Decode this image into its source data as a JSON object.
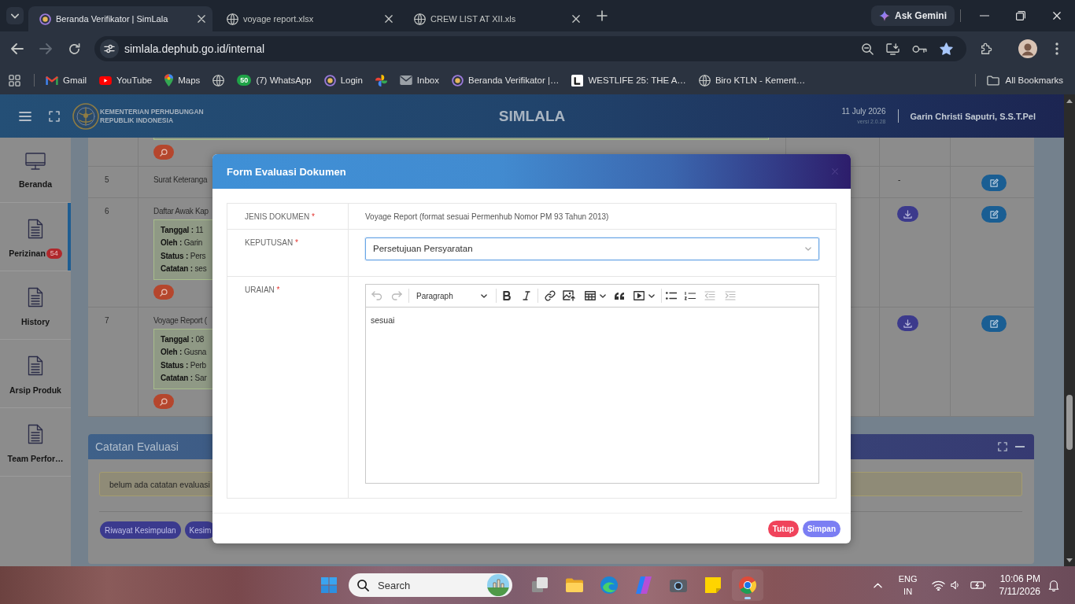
{
  "browser": {
    "tabs": [
      {
        "title": "Beranda Verifikator | SimLala",
        "selected": true
      },
      {
        "title": "voyage report.xlsx",
        "selected": false
      },
      {
        "title": "CREW LIST AT XII.xls",
        "selected": false
      }
    ],
    "gemini_button": "Ask Gemini",
    "forward_disabled": true,
    "address": "simlala.dephub.go.id/internal",
    "bookmarked": true,
    "bookmarks": [
      {
        "kind": "link",
        "label": "Gmail"
      },
      {
        "kind": "link",
        "label": "YouTube"
      },
      {
        "kind": "link",
        "label": "Maps"
      },
      {
        "kind": "icon"
      },
      {
        "kind": "link",
        "label": "(7) WhatsApp",
        "badge": "50"
      },
      {
        "kind": "link",
        "label": "Login"
      },
      {
        "kind": "icon"
      },
      {
        "kind": "link",
        "label": "Inbox"
      },
      {
        "kind": "link",
        "label": "Beranda Verifikator |…"
      },
      {
        "kind": "link",
        "label": "WESTLIFE 25: THE A…"
      },
      {
        "kind": "link",
        "label": "Biro KTLN - Kement…"
      }
    ],
    "all_bookmarks": "All Bookmarks"
  },
  "app": {
    "header": {
      "org_name": "KEMENTERIAN PERHUBUNGAN",
      "org_country": "REPUBLIK INDONESIA",
      "title": "SIMLALA",
      "date": "11 July 2026",
      "version": "versi 2.0.28",
      "user": "Garin Christi Saputri, S.S.T.Pel"
    },
    "sidebar": [
      {
        "label": "Beranda",
        "selected": false
      },
      {
        "label": "Perizinan",
        "badge": "54",
        "selected": true
      },
      {
        "label": "History",
        "selected": false
      },
      {
        "label": "Arsip Produk",
        "selected": false
      },
      {
        "label": "Team Perfor…",
        "selected": false
      }
    ],
    "documents": [
      {
        "kind": "cut",
        "preview_button": true
      },
      {
        "kind": "document",
        "number": "5",
        "name": "Surat Keteranga",
        "column_4": "-",
        "preview_button": false,
        "download_button": false,
        "edit_button": true
      },
      {
        "kind": "document",
        "number": "6",
        "name": "Daftar Awak Kap",
        "details": [
          {
            "label": "Tanggal :",
            "value": "11"
          },
          {
            "label": "Oleh :",
            "value": "Garin"
          },
          {
            "label": "Status :",
            "value": "Pers"
          },
          {
            "label": "Catatan :",
            "value": "ses"
          }
        ],
        "preview_button": true,
        "download_button": true,
        "edit_button": true
      },
      {
        "kind": "document",
        "number": "7",
        "name": "Voyage Report (",
        "details": [
          {
            "label": "Tanggal :",
            "value": "08"
          },
          {
            "label": "Oleh :",
            "value": "Gusna"
          },
          {
            "label": "Status :",
            "value": "Perb"
          },
          {
            "label": "Catatan :",
            "value": "Sar"
          }
        ],
        "preview_button": true,
        "download_button": true,
        "edit_button": true
      }
    ],
    "evaluation_notes": {
      "title": "Catatan Evaluasi",
      "message": "belum ada catatan evaluasi",
      "buttons": [
        "Riwayat Kesimpulan",
        "Kesim"
      ]
    }
  },
  "modal": {
    "title": "Form Evaluasi Dokumen",
    "fields": [
      {
        "kind": "text",
        "label": "JENIS DOKUMEN",
        "required_mark": "*",
        "value": "Voyage Report (format sesuai Permenhub Nomor PM 93 Tahun 2013)"
      },
      {
        "kind": "select",
        "label": "KEPUTUSAN",
        "required_mark": "*",
        "value": "Persetujuan Persyaratan",
        "focused": true
      },
      {
        "kind": "editor",
        "label": "URAIAN",
        "required_mark": "*",
        "history_tools": [
          {
            "disabled": true
          },
          {
            "disabled": true
          }
        ],
        "block_format": "Paragraph",
        "tools": [
          {
            "disabled": false
          },
          {
            "disabled": false
          },
          {
            "disabled": false
          },
          {
            "disabled": false
          },
          {
            "disabled": false
          },
          {
            "disabled": false
          },
          {
            "disabled": false
          },
          {
            "disabled": false
          },
          {
            "disabled": false
          },
          {
            "disabled": true
          },
          {
            "disabled": true
          }
        ],
        "content": "sesuai"
      }
    ],
    "buttons": [
      {
        "kind": "danger",
        "label": "Tutup"
      },
      {
        "kind": "primary",
        "label": "Simpan"
      }
    ]
  },
  "taskbar": {
    "search_placeholder": "Search",
    "apps": [
      {
        "active": false
      },
      {
        "active": false
      },
      {
        "active": false
      },
      {
        "active": false
      },
      {
        "active": false
      },
      {
        "active": false
      },
      {
        "active": true
      }
    ],
    "language": "ENG",
    "region": "IN",
    "time": "10:06 PM",
    "date": "7/11/2026"
  }
}
